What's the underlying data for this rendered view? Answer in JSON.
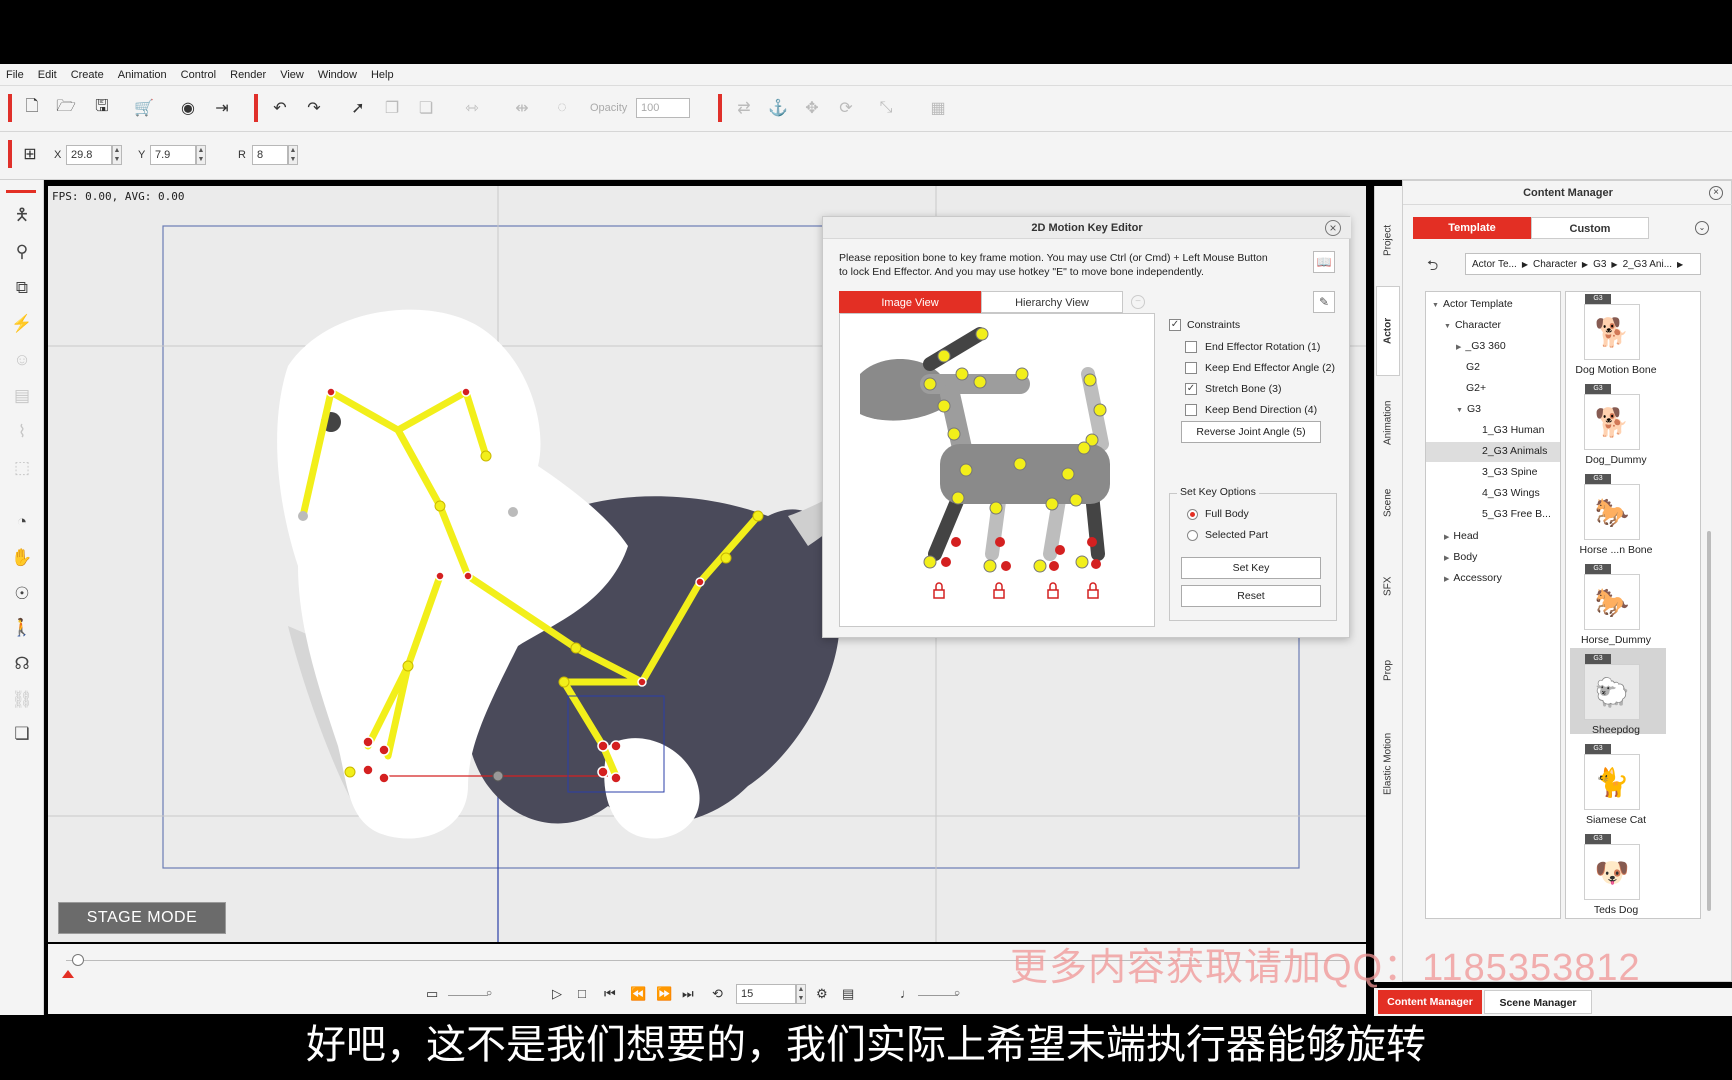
{
  "menu": [
    "File",
    "Edit",
    "Create",
    "Animation",
    "Control",
    "Render",
    "View",
    "Window",
    "Help"
  ],
  "toolbar": {
    "opacity_label": "Opacity",
    "opacity_value": "100"
  },
  "transform": {
    "x_label": "X",
    "x_value": "29.8",
    "y_label": "Y",
    "y_value": "7.9",
    "r_label": "R",
    "r_value": "8"
  },
  "stage": {
    "fps": "FPS: 0.00, AVG: 0.00",
    "mode_label": "STAGE MODE"
  },
  "timeline": {
    "frame_value": "15"
  },
  "dialog": {
    "title": "2D Motion Key Editor",
    "instruction": "Please reposition bone to key frame motion. You may use Ctrl (or Cmd) + Left Mouse Button to lock End Effector. And you may use hotkey \"E\" to move bone independently.",
    "tabs": [
      "Image View",
      "Hierarchy View"
    ],
    "constraints_label": "Constraints",
    "options": [
      {
        "label": "End Effector Rotation (1)",
        "checked": false
      },
      {
        "label": "Keep End Effector Angle (2)",
        "checked": false
      },
      {
        "label": "Stretch Bone (3)",
        "checked": true
      },
      {
        "label": "Keep Bend Direction (4)",
        "checked": false
      }
    ],
    "reverse_button": "Reverse Joint Angle (5)",
    "set_key_options_label": "Set Key Options",
    "radio_full": "Full Body",
    "radio_selected": "Selected Part",
    "set_key_button": "Set Key",
    "reset_button": "Reset"
  },
  "side_tabs": [
    "Project",
    "Actor",
    "Animation",
    "Scene",
    "SFX",
    "Prop",
    "Elastic Motion"
  ],
  "content_manager": {
    "title": "Content Manager",
    "tabs": [
      "Template",
      "Custom"
    ],
    "breadcrumb": [
      "Actor Te...",
      "Character",
      "G3",
      "2_G3 Ani..."
    ],
    "tree": [
      {
        "label": "Actor Template",
        "level": 0,
        "arrow": "down"
      },
      {
        "label": "Character",
        "level": 1,
        "arrow": "down"
      },
      {
        "label": "_G3 360",
        "level": 2,
        "arrow": "right"
      },
      {
        "label": "G2",
        "level": 2,
        "arrow": ""
      },
      {
        "label": "G2+",
        "level": 2,
        "arrow": ""
      },
      {
        "label": "G3",
        "level": 2,
        "arrow": "down"
      },
      {
        "label": "1_G3 Human",
        "level": 3,
        "arrow": ""
      },
      {
        "label": "2_G3 Animals",
        "level": 3,
        "arrow": "",
        "selected": true
      },
      {
        "label": "3_G3 Spine",
        "level": 3,
        "arrow": ""
      },
      {
        "label": "4_G3 Wings",
        "level": 3,
        "arrow": ""
      },
      {
        "label": "5_G3 Free B...",
        "level": 3,
        "arrow": ""
      },
      {
        "label": "Head",
        "level": 1,
        "arrow": "right"
      },
      {
        "label": "Body",
        "level": 1,
        "arrow": "right"
      },
      {
        "label": "Accessory",
        "level": 1,
        "arrow": "right"
      }
    ],
    "items": [
      {
        "name": "Dog Motion Bone",
        "badge": "G3"
      },
      {
        "name": "Dog_Dummy",
        "badge": "G3"
      },
      {
        "name": "Horse ...n Bone",
        "badge": "G3"
      },
      {
        "name": "Horse_Dummy",
        "badge": "G3"
      },
      {
        "name": "Sheepdog",
        "badge": "G3",
        "selected": true
      },
      {
        "name": "Siamese Cat",
        "badge": "G3"
      },
      {
        "name": "Teds Dog",
        "badge": "G3"
      }
    ]
  },
  "bottom_tabs": [
    "Content Manager",
    "Scene Manager"
  ],
  "watermark": "更多内容获取请加QQ：1185353812",
  "subtitle": "好吧，这不是我们想要的，我们实际上希望末端执行器能够旋转",
  "colors": {
    "accent": "#e32f24",
    "bone": "#f2ef1a",
    "joint_red": "#d42020"
  }
}
